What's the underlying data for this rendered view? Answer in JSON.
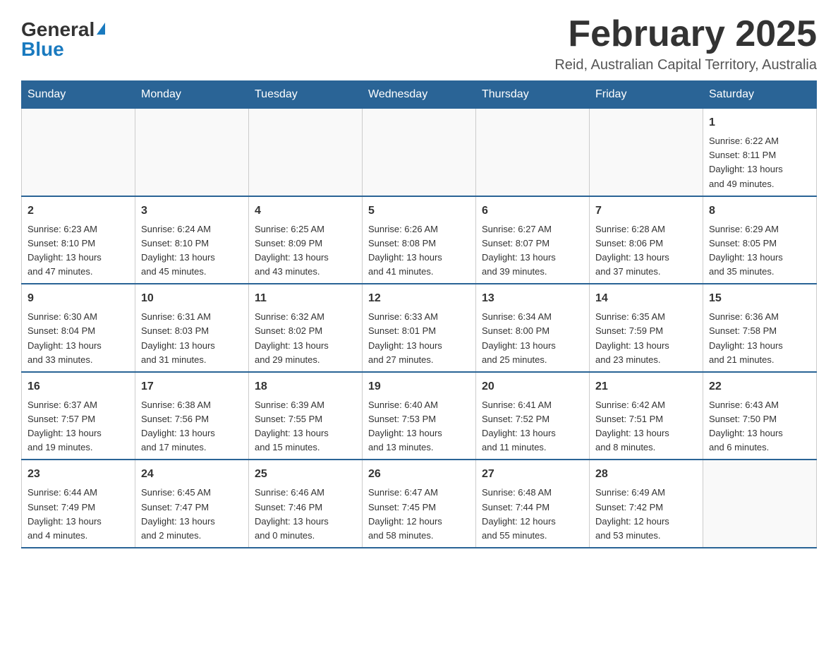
{
  "header": {
    "logo_general": "General",
    "logo_blue": "Blue",
    "month_title": "February 2025",
    "location": "Reid, Australian Capital Territory, Australia"
  },
  "weekdays": [
    "Sunday",
    "Monday",
    "Tuesday",
    "Wednesday",
    "Thursday",
    "Friday",
    "Saturday"
  ],
  "weeks": [
    [
      {
        "day": "",
        "info": ""
      },
      {
        "day": "",
        "info": ""
      },
      {
        "day": "",
        "info": ""
      },
      {
        "day": "",
        "info": ""
      },
      {
        "day": "",
        "info": ""
      },
      {
        "day": "",
        "info": ""
      },
      {
        "day": "1",
        "info": "Sunrise: 6:22 AM\nSunset: 8:11 PM\nDaylight: 13 hours\nand 49 minutes."
      }
    ],
    [
      {
        "day": "2",
        "info": "Sunrise: 6:23 AM\nSunset: 8:10 PM\nDaylight: 13 hours\nand 47 minutes."
      },
      {
        "day": "3",
        "info": "Sunrise: 6:24 AM\nSunset: 8:10 PM\nDaylight: 13 hours\nand 45 minutes."
      },
      {
        "day": "4",
        "info": "Sunrise: 6:25 AM\nSunset: 8:09 PM\nDaylight: 13 hours\nand 43 minutes."
      },
      {
        "day": "5",
        "info": "Sunrise: 6:26 AM\nSunset: 8:08 PM\nDaylight: 13 hours\nand 41 minutes."
      },
      {
        "day": "6",
        "info": "Sunrise: 6:27 AM\nSunset: 8:07 PM\nDaylight: 13 hours\nand 39 minutes."
      },
      {
        "day": "7",
        "info": "Sunrise: 6:28 AM\nSunset: 8:06 PM\nDaylight: 13 hours\nand 37 minutes."
      },
      {
        "day": "8",
        "info": "Sunrise: 6:29 AM\nSunset: 8:05 PM\nDaylight: 13 hours\nand 35 minutes."
      }
    ],
    [
      {
        "day": "9",
        "info": "Sunrise: 6:30 AM\nSunset: 8:04 PM\nDaylight: 13 hours\nand 33 minutes."
      },
      {
        "day": "10",
        "info": "Sunrise: 6:31 AM\nSunset: 8:03 PM\nDaylight: 13 hours\nand 31 minutes."
      },
      {
        "day": "11",
        "info": "Sunrise: 6:32 AM\nSunset: 8:02 PM\nDaylight: 13 hours\nand 29 minutes."
      },
      {
        "day": "12",
        "info": "Sunrise: 6:33 AM\nSunset: 8:01 PM\nDaylight: 13 hours\nand 27 minutes."
      },
      {
        "day": "13",
        "info": "Sunrise: 6:34 AM\nSunset: 8:00 PM\nDaylight: 13 hours\nand 25 minutes."
      },
      {
        "day": "14",
        "info": "Sunrise: 6:35 AM\nSunset: 7:59 PM\nDaylight: 13 hours\nand 23 minutes."
      },
      {
        "day": "15",
        "info": "Sunrise: 6:36 AM\nSunset: 7:58 PM\nDaylight: 13 hours\nand 21 minutes."
      }
    ],
    [
      {
        "day": "16",
        "info": "Sunrise: 6:37 AM\nSunset: 7:57 PM\nDaylight: 13 hours\nand 19 minutes."
      },
      {
        "day": "17",
        "info": "Sunrise: 6:38 AM\nSunset: 7:56 PM\nDaylight: 13 hours\nand 17 minutes."
      },
      {
        "day": "18",
        "info": "Sunrise: 6:39 AM\nSunset: 7:55 PM\nDaylight: 13 hours\nand 15 minutes."
      },
      {
        "day": "19",
        "info": "Sunrise: 6:40 AM\nSunset: 7:53 PM\nDaylight: 13 hours\nand 13 minutes."
      },
      {
        "day": "20",
        "info": "Sunrise: 6:41 AM\nSunset: 7:52 PM\nDaylight: 13 hours\nand 11 minutes."
      },
      {
        "day": "21",
        "info": "Sunrise: 6:42 AM\nSunset: 7:51 PM\nDaylight: 13 hours\nand 8 minutes."
      },
      {
        "day": "22",
        "info": "Sunrise: 6:43 AM\nSunset: 7:50 PM\nDaylight: 13 hours\nand 6 minutes."
      }
    ],
    [
      {
        "day": "23",
        "info": "Sunrise: 6:44 AM\nSunset: 7:49 PM\nDaylight: 13 hours\nand 4 minutes."
      },
      {
        "day": "24",
        "info": "Sunrise: 6:45 AM\nSunset: 7:47 PM\nDaylight: 13 hours\nand 2 minutes."
      },
      {
        "day": "25",
        "info": "Sunrise: 6:46 AM\nSunset: 7:46 PM\nDaylight: 13 hours\nand 0 minutes."
      },
      {
        "day": "26",
        "info": "Sunrise: 6:47 AM\nSunset: 7:45 PM\nDaylight: 12 hours\nand 58 minutes."
      },
      {
        "day": "27",
        "info": "Sunrise: 6:48 AM\nSunset: 7:44 PM\nDaylight: 12 hours\nand 55 minutes."
      },
      {
        "day": "28",
        "info": "Sunrise: 6:49 AM\nSunset: 7:42 PM\nDaylight: 12 hours\nand 53 minutes."
      },
      {
        "day": "",
        "info": ""
      }
    ]
  ]
}
